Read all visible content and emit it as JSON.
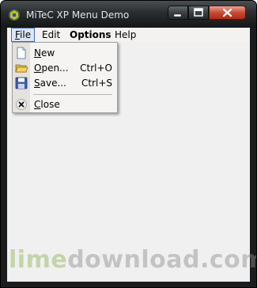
{
  "window": {
    "title": "MiTeC XP Menu Demo"
  },
  "menubar": {
    "items": [
      {
        "label": "File",
        "accel": "F",
        "rest": "ile"
      },
      {
        "label": "Edit",
        "accel": "E",
        "rest": "dit"
      },
      {
        "label": "Options",
        "accel": "O",
        "rest": "ptions"
      },
      {
        "label": "Help",
        "accel": "H",
        "rest": "elp"
      }
    ]
  },
  "file_menu": {
    "items": [
      {
        "label": "New",
        "accel": "N",
        "rest": "ew",
        "shortcut": "",
        "icon": "new-document-icon"
      },
      {
        "label": "Open...",
        "accel": "O",
        "rest": "pen...",
        "shortcut": "Ctrl+O",
        "icon": "open-folder-icon"
      },
      {
        "label": "Save...",
        "accel": "S",
        "rest": "ave...",
        "shortcut": "Ctrl+S",
        "icon": "save-disk-icon"
      },
      {
        "label": "Close",
        "accel": "C",
        "rest": "lose",
        "shortcut": "",
        "icon": "close-icon"
      }
    ]
  },
  "watermark": {
    "part1": "lime",
    "part2": "download.com"
  },
  "colors": {
    "title_bar": "#2a2d2f",
    "close_button": "#c94a33",
    "menu_highlight": "#dde6f7",
    "menu_highlight_border": "#3d6bb8"
  }
}
